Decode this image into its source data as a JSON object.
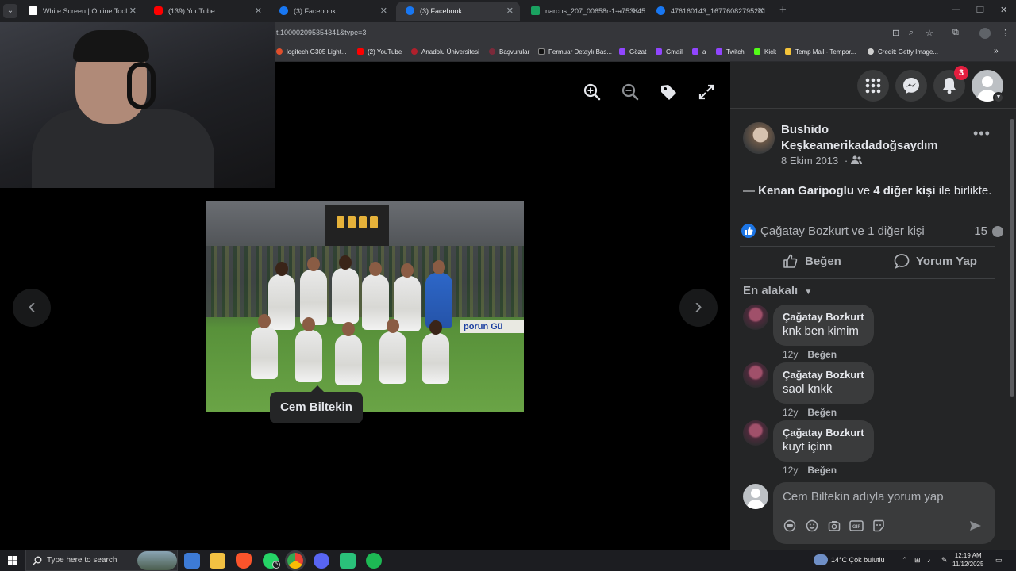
{
  "browser": {
    "tabs": [
      {
        "title": "White Screen | Online Tool",
        "active": false,
        "favicon_color": "#ffffff"
      },
      {
        "title": "(139) YouTube",
        "active": false,
        "favicon_color": "#ff0000"
      },
      {
        "title": "(3) Facebook",
        "active": false,
        "favicon_color": "#1877f2"
      },
      {
        "title": "(3) Facebook",
        "active": true,
        "favicon_color": "#1877f2"
      },
      {
        "title": "narcos_207_00658r-1-a753b45",
        "active": false,
        "favicon_color": "#1aa260"
      },
      {
        "title": "476160143_16776082795201",
        "active": false,
        "favicon_color": "#1877f2"
      }
    ],
    "url": "t.100002095354341&type=3",
    "bookmarks": [
      {
        "label": "logitech G305 Light...",
        "color": "#e04f2c"
      },
      {
        "label": "(2) YouTube",
        "color": "#ff0000"
      },
      {
        "label": "Anadolu Üniversitesi",
        "color": "#b0202c"
      },
      {
        "label": "Başvurular",
        "color": "#7b2a3a"
      },
      {
        "label": "Fermuar Detaylı Bas...",
        "color": "#111111"
      },
      {
        "label": "Gözat",
        "color": "#9146ff"
      },
      {
        "label": "Gmail",
        "color": "#9146ff"
      },
      {
        "label": "a",
        "color": "#9146ff"
      },
      {
        "label": "Twitch",
        "color": "#9146ff"
      },
      {
        "label": "Kick",
        "color": "#53fc18"
      },
      {
        "label": "Temp Mail - Tempor...",
        "color": "#f5c43a"
      },
      {
        "label": "Credit: Getty Image...",
        "color": "#cfcfcf"
      }
    ]
  },
  "viewer": {
    "tools": [
      "zoom-in-icon",
      "zoom-out-icon",
      "tag-icon",
      "fullscreen-icon"
    ],
    "tag_label": "Cem Biltekin",
    "ad_text": "porun Gü"
  },
  "panel": {
    "notification_count": "3",
    "author_name": "Bushido Keşkeamerikadadoğsaydım",
    "post_date": "8 Ekim 2013",
    "with_prefix": "—",
    "with_person": "Kenan Garipoglu",
    "with_and": "ve",
    "with_others": "4 diğer kişi",
    "with_suffix": "ile birlikte.",
    "reaction_names": "Çağatay Bozkurt ve 1 diğer kişi",
    "comment_count": "15",
    "like_label": "Beğen",
    "comment_label": "Yorum Yap",
    "sort_label": "En alakalı",
    "comments": [
      {
        "author": "Çağatay Bozkurt",
        "text": "knk ben kimim",
        "age": "12y",
        "like": "Beğen"
      },
      {
        "author": "Çağatay Bozkurt",
        "text": "saol knkk",
        "age": "12y",
        "like": "Beğen"
      },
      {
        "author": "Çağatay Bozkurt",
        "text": "kuyt içinn",
        "age": "12y",
        "like": "Beğen"
      }
    ],
    "composer_placeholder": "Cem Biltekin adıyla yorum yap"
  },
  "taskbar": {
    "search_placeholder": "Type here to search",
    "weather": "14°C  Çok bulutlu",
    "time": "12:19 AM",
    "date": "11/12/2025",
    "whatsapp_badge": "5"
  },
  "colors": {
    "fb_blue": "#1b74e4",
    "panel_bg": "#242526",
    "bubble_bg": "#3a3b3c",
    "badge_red": "#e41e3f"
  }
}
